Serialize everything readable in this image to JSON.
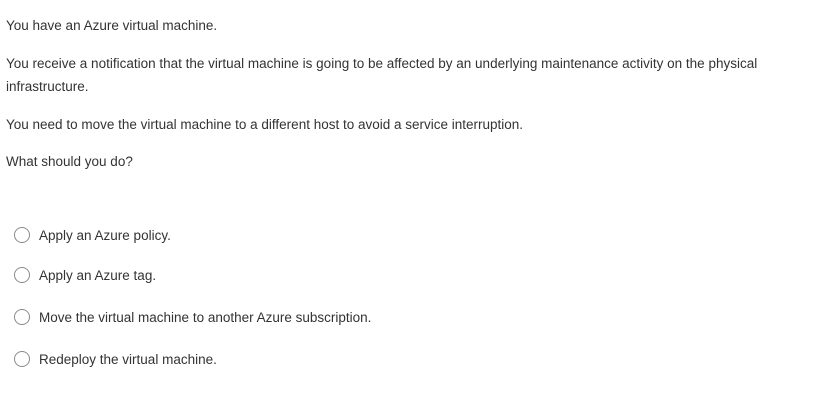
{
  "question": {
    "paragraphs": [
      "You have an Azure virtual machine.",
      "You receive a notification that the virtual machine is going to be affected by an underlying maintenance activity on the physical infrastructure.",
      "You need to move the virtual machine to a different host to avoid a service interruption.",
      "What should you do?"
    ]
  },
  "options": [
    {
      "label": "Apply an Azure policy.",
      "selected": false
    },
    {
      "label": "Apply an Azure tag.",
      "selected": false
    },
    {
      "label": "Move the virtual machine to another Azure subscription.",
      "selected": false
    },
    {
      "label": "Redeploy the virtual machine.",
      "selected": false
    }
  ]
}
